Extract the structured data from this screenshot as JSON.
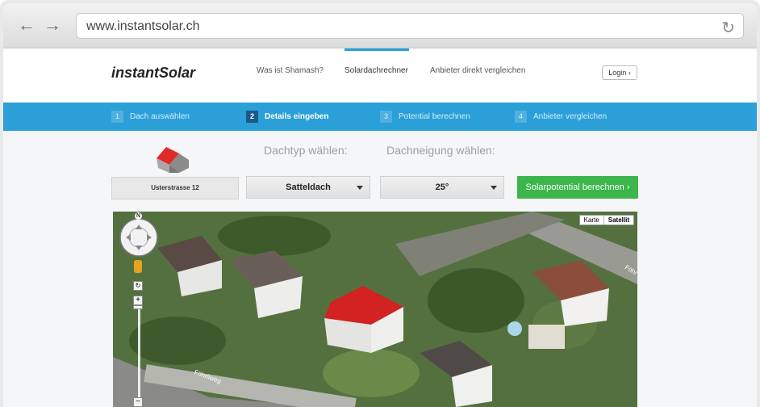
{
  "browser": {
    "url": "www.instantsolar.ch"
  },
  "header": {
    "logo": "instantSolar",
    "nav": [
      "Was ist Shamash?",
      "Solardachrechner",
      "Anbieter direkt vergleichen"
    ],
    "active_nav": "Solardachrechner",
    "login": "Login ›"
  },
  "steps": [
    {
      "num": "1",
      "label": "Dach auswählen"
    },
    {
      "num": "2",
      "label": "Details eingeben",
      "current": true
    },
    {
      "num": "3",
      "label": "Potential berechnen"
    },
    {
      "num": "4",
      "label": "Anbieter vergleichen"
    }
  ],
  "form": {
    "roof_type_heading": "Dachtyp wählen:",
    "roof_pitch_heading": "Dachneigung wählen:",
    "address": "Usterstrasse 12",
    "roof_type": "Satteldach",
    "roof_pitch": "25°",
    "calculate": "Solarpotential berechnen ›"
  },
  "map": {
    "compass_n": "N",
    "map_types": [
      "Karte",
      "Satellit"
    ],
    "selected_type": "Satellit",
    "street_1": "Föhrliweg",
    "street_2": "Föhr",
    "highlight_color": "#cc2222"
  },
  "colors": {
    "accent": "#2a9fd8",
    "button": "#3cb54a"
  }
}
